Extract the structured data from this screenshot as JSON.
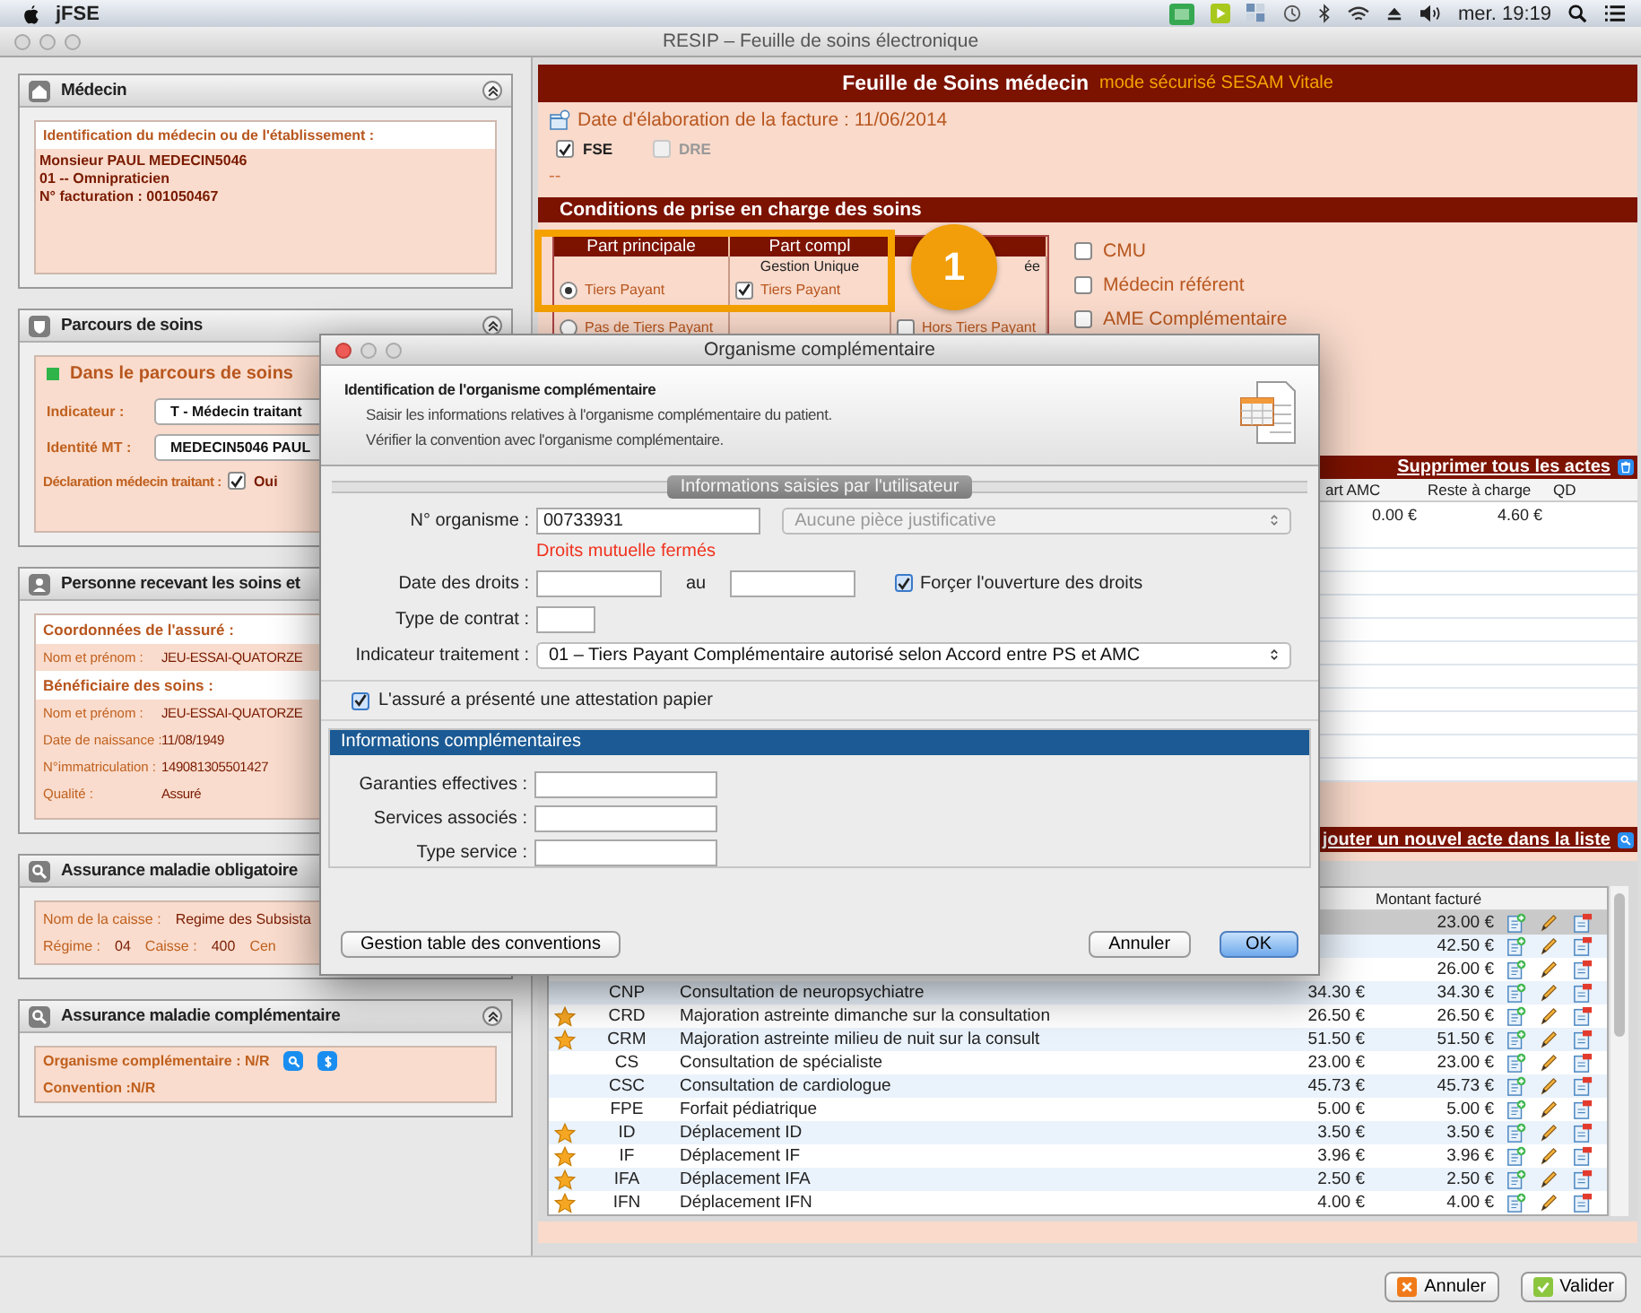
{
  "menubar": {
    "app": "jFSE",
    "clock": "mer. 19:19"
  },
  "window": {
    "title": "RESIP – Feuille de soins électronique"
  },
  "medecin": {
    "title": "Médecin",
    "collapse_button": true,
    "heading": "Identification du médecin ou de l'établissement :",
    "lines": [
      "Monsieur PAUL MEDECIN5046",
      "01 -- Omnipraticien",
      "N° facturation : 001050467"
    ]
  },
  "parcours": {
    "title": "Parcours de soins",
    "collapse_button": true,
    "status": "Dans le parcours de soins",
    "fields": [
      {
        "label": "Indicateur :",
        "value": "T - Médecin traitant"
      },
      {
        "label": "Identité MT :",
        "value": "MEDECIN5046 PAUL"
      }
    ],
    "declaration": {
      "label": "Déclaration médecin traitant :",
      "option": "Oui",
      "checked": true
    }
  },
  "personne": {
    "title": "Personne recevant les soins et",
    "sections": [
      {
        "heading": "Coordonnées de l'assuré :",
        "rows": [
          {
            "label": "Nom et prénom :",
            "value": "JEU-ESSAI-QUATORZE"
          }
        ]
      },
      {
        "heading": "Bénéficiaire des soins :",
        "rows": [
          {
            "label": "Nom et prénom :",
            "value": "JEU-ESSAI-QUATORZE"
          },
          {
            "label": "Date de naissance :",
            "value": "11/08/1949"
          },
          {
            "label": "N°immatriculation :",
            "value": "149081305501427"
          },
          {
            "label": "Qualité :",
            "value": "Assuré"
          }
        ]
      }
    ]
  },
  "amo": {
    "title": "Assurance maladie obligatoire",
    "rows": [
      [
        {
          "label": "Nom de la caisse :",
          "value": "Regime des Subsista"
        }
      ],
      [
        {
          "label": "Régime :",
          "value": "04"
        },
        {
          "label": "Caisse :",
          "value": "400"
        },
        {
          "label": "Cen"
        }
      ]
    ]
  },
  "amc": {
    "title": "Assurance maladie complémentaire",
    "collapse_button": true,
    "organisme": "Organisme complémentaire : N/R",
    "convention": "Convention :N/R"
  },
  "feuille": {
    "title": "Feuille de Soins médecin",
    "mode": "mode sécurisé SESAM Vitale",
    "date": "Date d'élaboration de la facture : 11/06/2014",
    "types": [
      {
        "label": "FSE",
        "checked": true,
        "disabled": false
      },
      {
        "label": "DRE",
        "checked": false,
        "disabled": true
      }
    ],
    "dashes": "--"
  },
  "conditions": {
    "title": "Conditions de prise en charge des soins",
    "part_principale": {
      "header": "Part principale",
      "options": [
        {
          "label": "Tiers Payant",
          "selected": true
        },
        {
          "label": "Pas de Tiers Payant",
          "selected": false
        }
      ]
    },
    "part_complementaire": {
      "header": "Part compl",
      "subheader": "Gestion Unique",
      "options": [
        {
          "label": "Tiers Payant",
          "checked": true
        }
      ]
    },
    "column_3": {
      "subheader": "ée",
      "options": [
        {
          "label": "Hors Tiers Payant",
          "checked": false
        }
      ]
    },
    "flags": [
      {
        "label": "CMU",
        "checked": false
      },
      {
        "label": "Médecin référent",
        "checked": false
      },
      {
        "label": "AME Complémentaire",
        "checked": false
      }
    ]
  },
  "actes_resume": {
    "delete_link": "Supprimer tous les actes",
    "columns": [
      "art AMC",
      "Reste à charge",
      "QD"
    ],
    "rows": [
      [
        "0.00 €",
        "4.60 €"
      ]
    ]
  },
  "add_link": "jouter un nouvel acte dans la liste",
  "actes": {
    "columns": [
      "Montant facturé"
    ],
    "rows": [
      {
        "billed": "23.00 €",
        "selected": true
      },
      {
        "billed": "42.50 €",
        "selected": false
      },
      {
        "billed": "26.00 €",
        "selected": false
      },
      {
        "code": "CNP",
        "label": "Consultation de neuropsychiatre",
        "price": "34.30 €",
        "billed": "34.30 €",
        "starred": false,
        "selected": false
      },
      {
        "code": "CRD",
        "label": "Majoration astreinte dimanche sur la consultation",
        "price": "26.50 €",
        "billed": "26.50 €",
        "starred": true,
        "selected": false
      },
      {
        "code": "CRM",
        "label": "Majoration astreinte milieu de nuit sur la consult",
        "price": "51.50 €",
        "billed": "51.50 €",
        "starred": true,
        "selected": false
      },
      {
        "code": "CS",
        "label": "Consultation de spécialiste",
        "price": "23.00 €",
        "billed": "23.00 €",
        "starred": false,
        "selected": false
      },
      {
        "code": "CSC",
        "label": "Consultation de cardiologue",
        "price": "45.73 €",
        "billed": "45.73 €",
        "starred": false,
        "selected": false
      },
      {
        "code": "FPE",
        "label": "Forfait pédiatrique",
        "price": "5.00 €",
        "billed": "5.00 €",
        "starred": false,
        "selected": false
      },
      {
        "code": "ID",
        "label": "Déplacement ID",
        "price": "3.50 €",
        "billed": "3.50 €",
        "starred": true,
        "selected": false
      },
      {
        "code": "IF",
        "label": "Déplacement IF",
        "price": "3.96 €",
        "billed": "3.96 €",
        "starred": true,
        "selected": false
      },
      {
        "code": "IFA",
        "label": "Déplacement IFA",
        "price": "2.50 €",
        "billed": "2.50 €",
        "starred": true,
        "selected": false
      },
      {
        "code": "IFN",
        "label": "Déplacement IFN",
        "price": "4.00 €",
        "billed": "4.00 €",
        "starred": true,
        "selected": false
      }
    ]
  },
  "bottom_buttons": [
    {
      "label": "Annuler",
      "kind": "cancel"
    },
    {
      "label": "Valider",
      "kind": "confirm"
    }
  ],
  "annotation": {
    "badge": "1"
  },
  "dialog": {
    "title": "Organisme complémentaire",
    "heading": "Identification de l'organisme complémentaire",
    "description": [
      "Saisir les informations relatives à l'organisme complémentaire du patient.",
      "Vérifier la convention avec l'organisme complémentaire."
    ],
    "section_title": "Informations saisies par l'utilisateur",
    "organisme": {
      "label": "N° organisme :",
      "value": "00733931"
    },
    "justificatif": {
      "value": "Aucune pièce justificative",
      "disabled": true
    },
    "warning": "Droits mutuelle fermés",
    "date_droits": {
      "label": "Date des droits :",
      "separator": "au"
    },
    "force": {
      "label": "Forçer l'ouverture des droits",
      "checked": true
    },
    "type_contrat": {
      "label": "Type de contrat :"
    },
    "indicateur": {
      "label": "Indicateur traitement :",
      "value": "01 – Tiers Payant Complémentaire autorisé selon Accord entre PS et AMC"
    },
    "attestation": {
      "label": "L'assuré a présenté une attestation papier",
      "checked": true
    },
    "complementaires": {
      "title": "Informations complémentaires",
      "fields": [
        "Garanties effectives :",
        "Services associés :",
        "Type service :"
      ]
    },
    "buttons": {
      "conventions": "Gestion table des conventions",
      "cancel": "Annuler",
      "ok": "OK"
    }
  }
}
